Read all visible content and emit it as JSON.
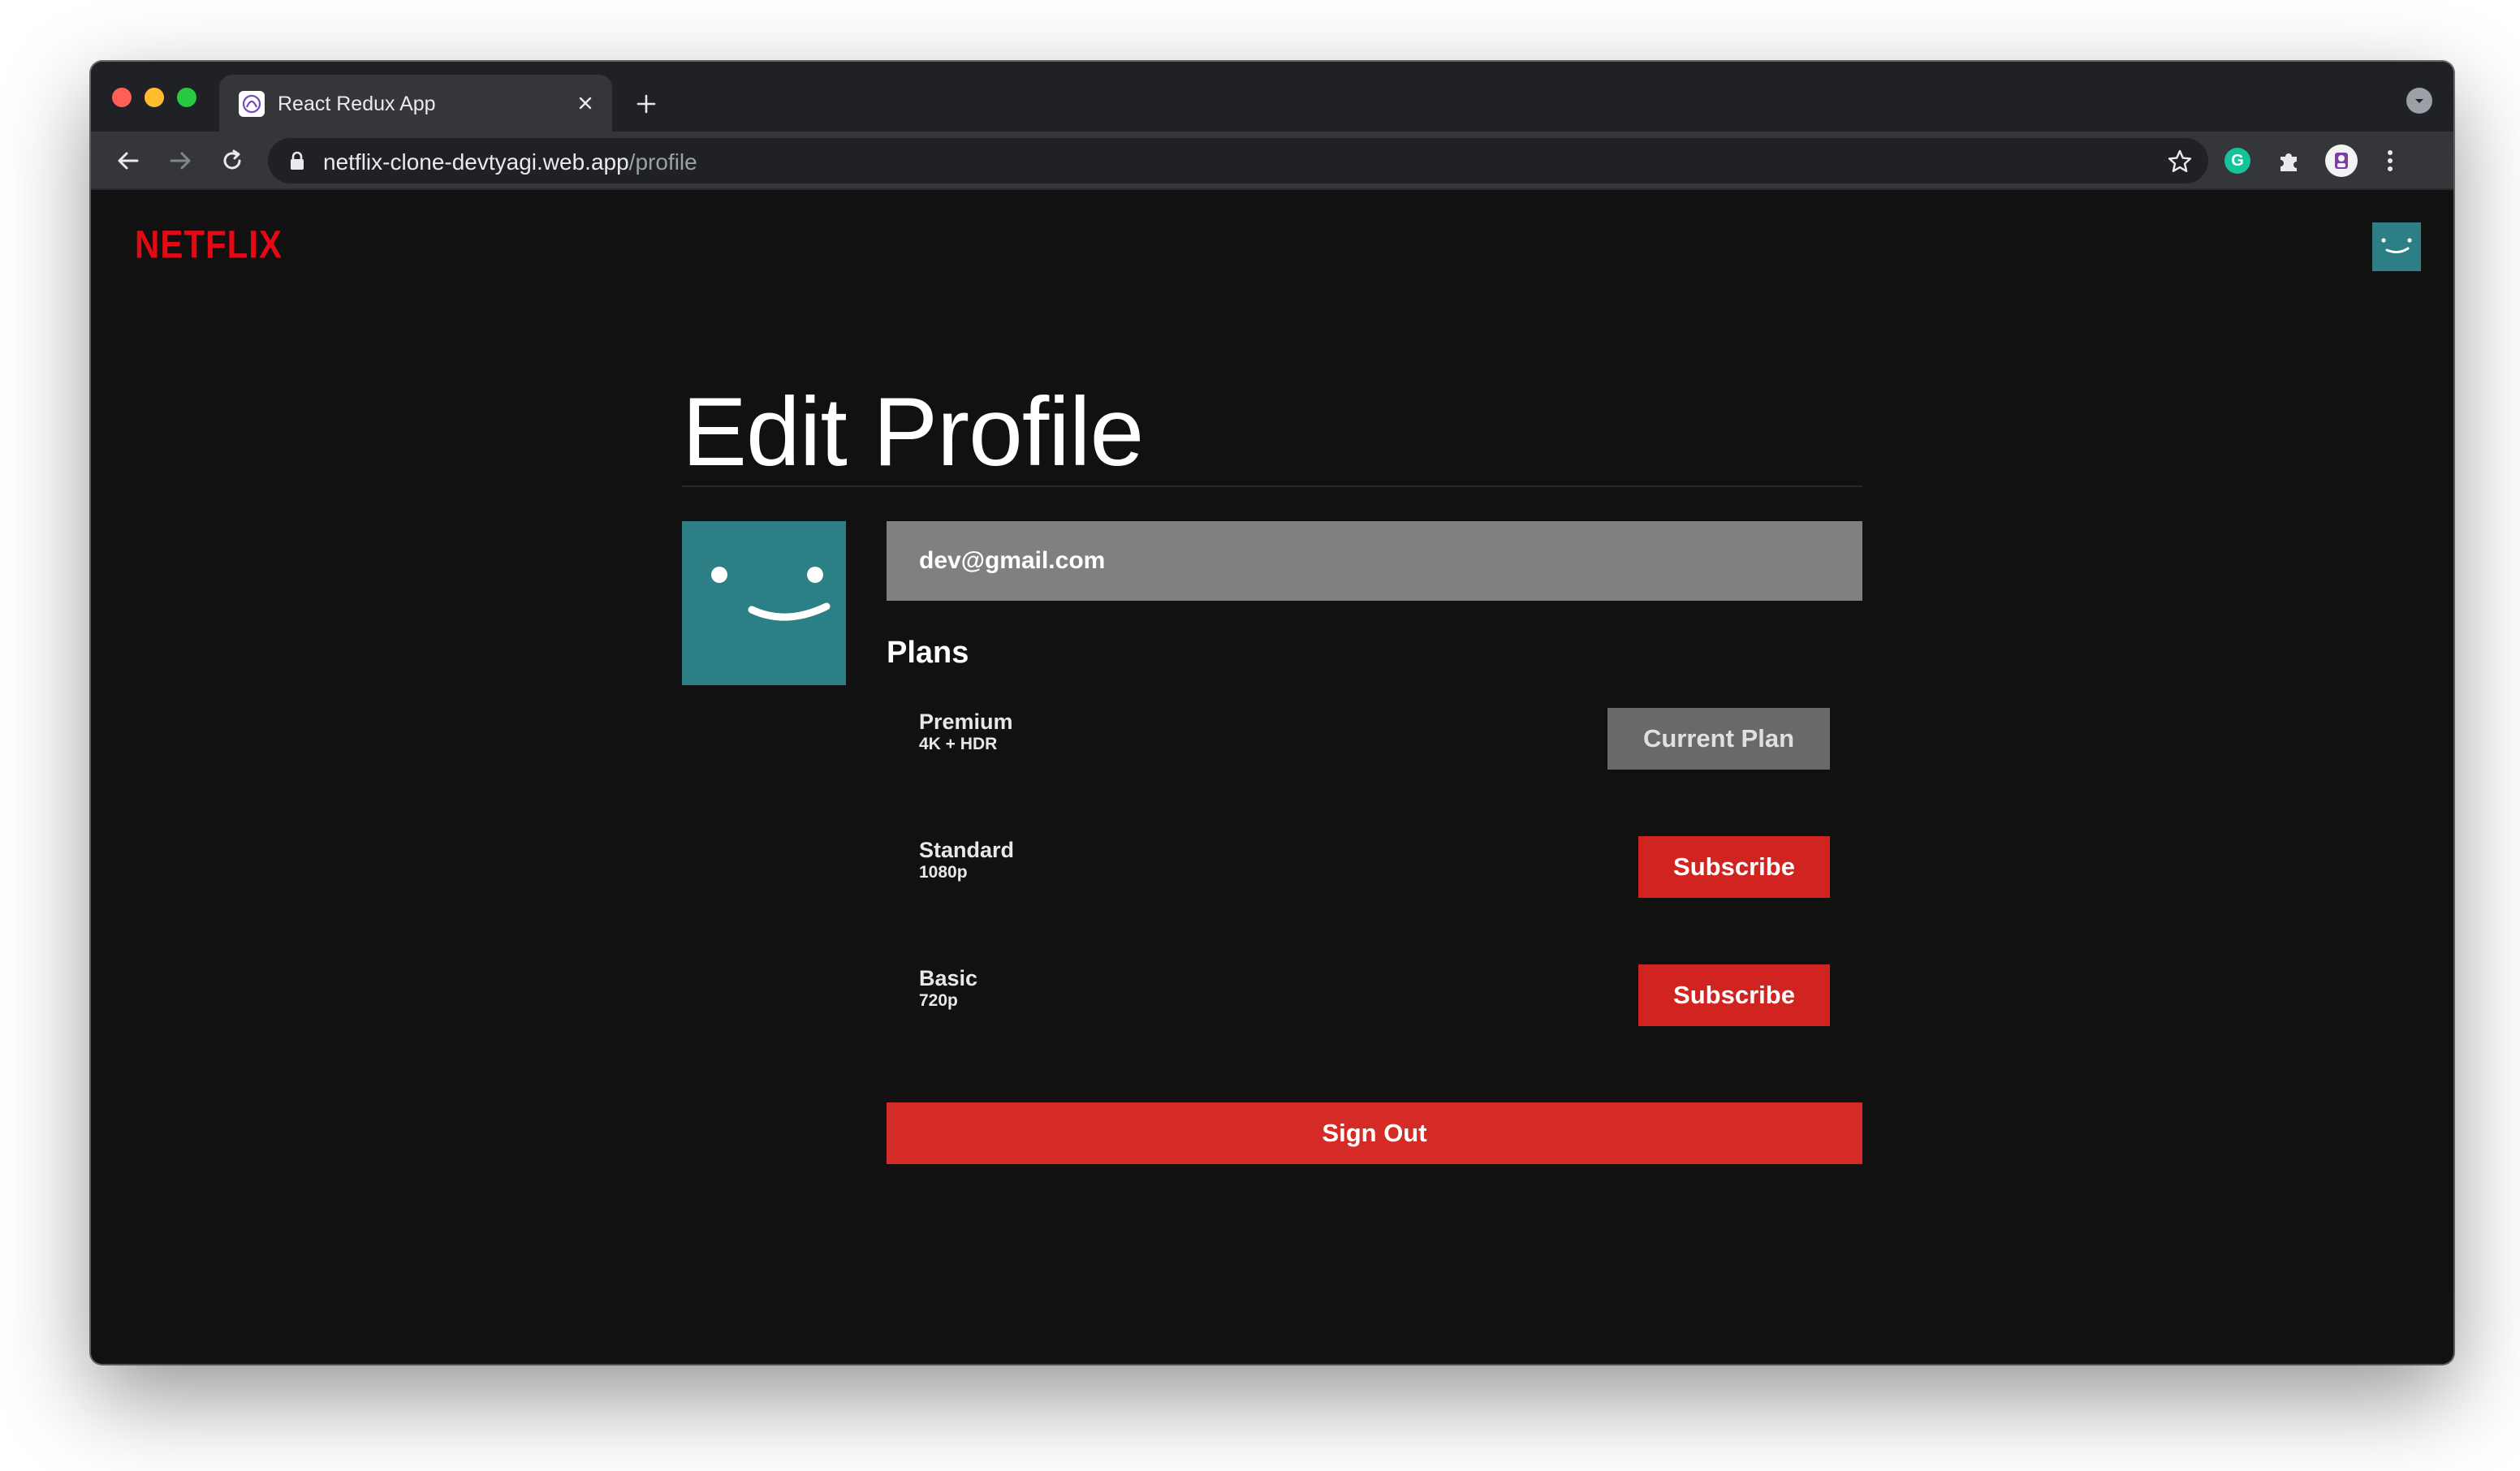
{
  "browser": {
    "tab_title": "React Redux App",
    "url_host": "netflix-clone-devtyagi.web.app",
    "url_path": "/profile",
    "tab_favicon": "react-redux-favicon",
    "extensions": [
      "grammarly-icon",
      "puzzle-icon",
      "profile-avatar-icon",
      "kebab-menu-icon"
    ],
    "grammarly_letter": "G"
  },
  "nav": {
    "logo_text": "NETFLIX",
    "brand_color": "#e50914",
    "avatar_color": "#2c7f84"
  },
  "profile": {
    "title": "Edit Profile",
    "email": "dev@gmail.com",
    "plans_heading": "Plans",
    "plans": [
      {
        "name": "Premium",
        "quality": "4K + HDR",
        "button": "Current Plan",
        "current": true
      },
      {
        "name": "Standard",
        "quality": "1080p",
        "button": "Subscribe",
        "current": false
      },
      {
        "name": "Basic",
        "quality": "720p",
        "button": "Subscribe",
        "current": false
      }
    ],
    "sign_out_label": "Sign Out"
  }
}
